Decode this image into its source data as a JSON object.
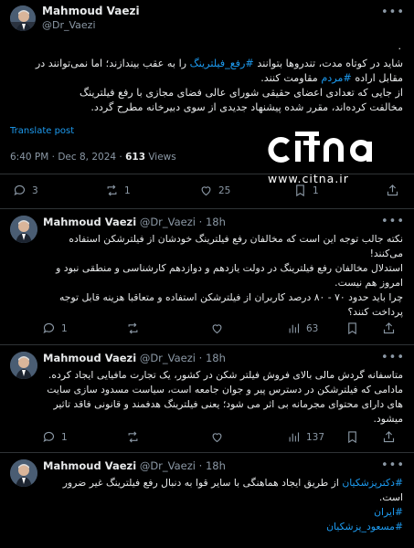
{
  "main": {
    "name": "Mahmoud Vaezi",
    "handle": "@Dr_Vaezi",
    "dot": ".",
    "lines": [
      {
        "parts": [
          {
            "t": "شاید در کوتاه مدت، تندروها بتوانند ",
            "tag": false
          },
          {
            "t": "#رفع_فیلترینگ",
            "tag": true
          },
          {
            "t": " را به عقب بیندازند؛ اما نمی‌توانند در",
            "tag": false
          }
        ]
      },
      {
        "parts": [
          {
            "t": "مقابل اراده ",
            "tag": false
          },
          {
            "t": "#مردم",
            "tag": true
          },
          {
            "t": " مقاومت کنند.",
            "tag": false
          }
        ]
      },
      {
        "parts": [
          {
            "t": "از جایی که تعدادی اعضای حقیقی شورای عالی فضای مجازی با رفع فیلترینگ",
            "tag": false
          }
        ]
      },
      {
        "parts": [
          {
            "t": "مخالفت کرده‌اند، مقرر شده پیشنهاد جدیدی از سوی دبیرخانه مطرح گردد.",
            "tag": false
          }
        ]
      }
    ],
    "translate_label": "Translate post",
    "time": "6:40 PM · Dec 8, 2024 · ",
    "views_count": "613",
    "views_label": " Views",
    "replies": "3",
    "reposts": "1",
    "likes": "25",
    "bookmarks": "1"
  },
  "watermark": {
    "logo": "CITNA",
    "url": "www.citna.ir"
  },
  "replies": [
    {
      "name": "Mahmoud Vaezi",
      "meta": " @Dr_Vaezi · 18h",
      "lines": [
        "نکته جالب توجه این است که مخالفان رفع فیلترینگ خودشان از فیلترشکن استفاده",
        "می‌کنند!",
        "استدلال مخالفان رفع فیلترینگ در دولت یازدهم و دوازدهم کارشناسی و منطقی نبود و",
        "امروز هم نیست.",
        "چرا باید حدود ۷۰ - ۸۰ درصد کاربران از فیلترشکن استفاده و متعاقبا هزینه قابل توجه",
        "پرداخت کنند؟"
      ],
      "replies": "1",
      "reposts": "",
      "likes": "63",
      "bookmarks": ""
    },
    {
      "name": "Mahmoud Vaezi",
      "meta": " @Dr_Vaezi · 18h",
      "lines": [
        "متاسفانه گردش مالی بالای فروش فیلتر شکن در کشور، یک تجارت مافیایی ایجاد کرده.",
        "مادامی که فیلترشکن در دسترس پیر و جوان جامعه است، سیاست مسدود سازی سایت",
        "های دارای محتوای مجرمانه بی اثر می شود؛ یعنی فیلترینگ هدفمند و قانونی فاقد تاثیر",
        "میشود."
      ],
      "replies": "1",
      "reposts": "",
      "likes": "137",
      "bookmarks": ""
    },
    {
      "name": "Mahmoud Vaezi",
      "meta": " @Dr_Vaezi · 18h",
      "line1_tag": "#دکترپزشکیان",
      "line1_rest": " از طریق ایجاد هماهنگی با سایر قوا به دنبال رفع فیلترینگ غیر ضرور",
      "line2": "است.",
      "tag2": "#ایران",
      "tag3": "#مسعود_پزشکیان"
    }
  ],
  "colors": {
    "background": "#000000",
    "text": "#e7e9ea",
    "muted": "#8b98a5",
    "link": "#1d9bf0",
    "divider": "#2f3336"
  },
  "icons": [
    "more-icon",
    "reply-icon",
    "repost-icon",
    "like-icon",
    "bookmark-icon",
    "share-icon",
    "views-icon",
    "avatar"
  ]
}
